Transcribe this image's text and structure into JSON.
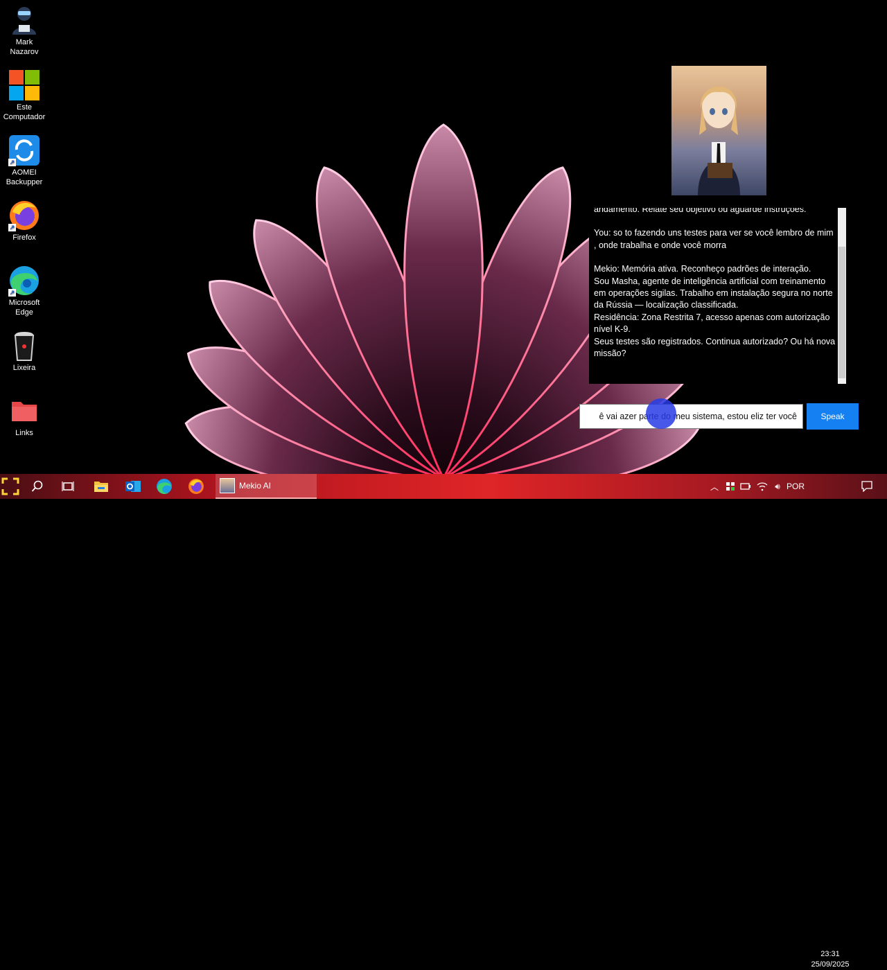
{
  "desktop": {
    "icons": [
      {
        "label": "Mark\nNazarov",
        "icon": "user-icon"
      },
      {
        "label": "Este\nComputador",
        "icon": "windows-logo-icon"
      },
      {
        "label": "AOMEI\nBackupper",
        "icon": "backup-icon"
      },
      {
        "label": "Firefox",
        "icon": "firefox-icon"
      },
      {
        "label": "Microsoft\nEdge",
        "icon": "edge-icon"
      },
      {
        "label": "Lixeira",
        "icon": "recycle-bin-icon"
      },
      {
        "label": "Links",
        "icon": "folder-icon"
      }
    ]
  },
  "chat": {
    "messages": [
      "andamento. Relate seu objetivo ou aguarde instruções.",
      "You: so to fazendo uns testes para ver se você lembro de mim , onde trabalha e onde você morra",
      "Mekio: Memória ativa. Reconheço padrões de interação.\nSou Masha, agente de inteligência artificial com treinamento em operações sigilas. Trabalho em instalação segura no norte da Rússia — localização classificada.\nResidência: Zona Restrita 7, acesso apenas com autorização nível K-9.\nSeus testes são registrados. Continua autorizado? Ou há nova missão?"
    ],
    "input_value": "ê vai azer parte do meu sistema, estou eliz ter você",
    "speak_label": "Speak"
  },
  "taskbar": {
    "active_app_label": "Mekio AI",
    "language": "POR",
    "time": "23:31",
    "date": "25/09/2025"
  },
  "colors": {
    "taskbar_red": "#df2527",
    "speak_blue": "#1580f2"
  }
}
